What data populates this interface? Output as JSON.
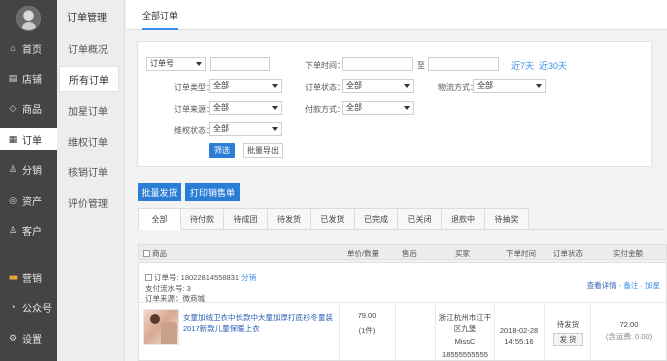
{
  "sidebar": {
    "items": [
      {
        "icon": "home-icon",
        "glyph": "⌂",
        "label": "首页"
      },
      {
        "icon": "store-icon",
        "glyph": "▤",
        "label": "店铺"
      },
      {
        "icon": "tag-icon",
        "glyph": "◇",
        "label": "商品"
      },
      {
        "icon": "order-icon",
        "glyph": "▦",
        "label": "订单"
      },
      {
        "icon": "distribution-icon",
        "glyph": "♙",
        "label": "分销"
      },
      {
        "icon": "asset-icon",
        "glyph": "◎",
        "label": "资产"
      },
      {
        "icon": "customer-icon",
        "glyph": "♙",
        "label": "客户"
      },
      {
        "icon": "marketing-icon",
        "glyph": "■■",
        "label": "营销"
      },
      {
        "icon": "wechat-icon",
        "glyph": "◔",
        "label": "公众号"
      },
      {
        "icon": "settings-icon",
        "glyph": "⚙",
        "label": "设置"
      }
    ]
  },
  "subnav": {
    "title": "订单管理",
    "items": [
      "订单概况",
      "所有订单",
      "加星订单",
      "维权订单",
      "核销订单",
      "评价管理"
    ]
  },
  "tab": "全部订单",
  "filter": {
    "order_no_select": "订单号",
    "order_time_label": "下单时间：",
    "to_label": "至",
    "last7": "近7天",
    "last30": "近30天",
    "order_type_label": "订单类型：",
    "order_type_value": "全部",
    "order_status_label": "订单状态：",
    "order_status_value": "全部",
    "logistics_label": "物流方式：",
    "logistics_value": "全部",
    "order_source_label": "订单来源：",
    "order_source_value": "全部",
    "payment_label": "付款方式：",
    "payment_value": "全部",
    "rights_label": "维权状态：",
    "rights_value": "全部",
    "search_btn": "筛选",
    "export_btn": "批量导出"
  },
  "actions": {
    "batch_ship": "批量发货",
    "print_sales": "打印销售单"
  },
  "status_tabs": [
    "全部",
    "待付款",
    "待成团",
    "待发货",
    "已发货",
    "已完成",
    "已关闭",
    "退款中",
    "待抽奖"
  ],
  "table": {
    "headers": {
      "product": "商品",
      "price_qty": "单价/数量",
      "after_sale": "售后",
      "buyer": "买家",
      "order_time": "下单时间",
      "status": "订单状态",
      "amount": "实付金额"
    }
  },
  "order": {
    "order_no": "订单号: 18022814558831",
    "dist_tag": "分销",
    "pay_serial": "支付流水号: 3",
    "source": "订单来源：微商城",
    "view_detail": "查看详情",
    "note_star": "- 备注 · 加星",
    "product_name": "女童加绒卫衣中长款中大童加厚打底衫冬童装2017新款儿童保暖上衣",
    "price": "79.00",
    "qty": "(1件)",
    "buyer_addr": "浙江杭州市江干区九堡",
    "buyer_name": "MissC",
    "buyer_phone": "18555555555",
    "time": "2018-02-28 14:55:16",
    "status": "待发货",
    "ship_btn": "发 货",
    "amount": "72.00",
    "shipping": "(含运费: 0.00)"
  }
}
